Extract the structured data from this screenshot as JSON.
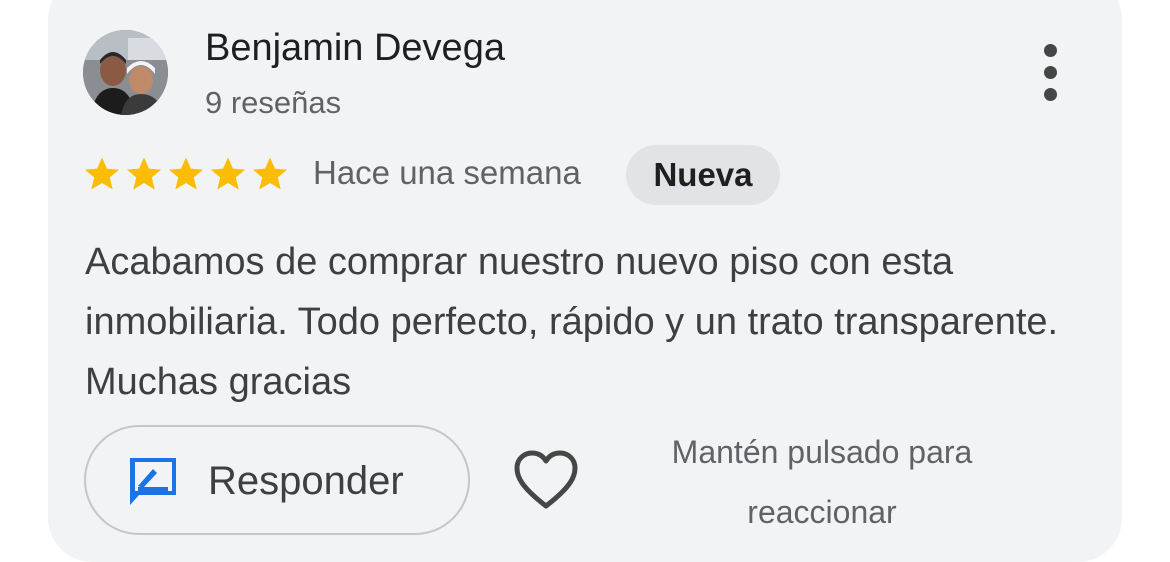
{
  "review": {
    "author_name": "Benjamin Devega",
    "review_count": "9 reseñas",
    "rating": 5,
    "rating_max": 5,
    "time": "Hace una semana",
    "badge": "Nueva",
    "text": "Acabamos de comprar nuestro nuevo piso con esta inmobiliaria. Todo perfecto, rápido y un trato transparente. Muchas gracias"
  },
  "actions": {
    "reply_label": "Responder",
    "react_hint": "Mantén pulsado para reaccionar"
  },
  "icons": {
    "avatar": "avatar-photo",
    "more": "more-vertical-icon",
    "star": "star-icon",
    "reply": "reply-edit-icon",
    "heart": "heart-outline-icon"
  },
  "colors": {
    "card_background": "#f2f3f5",
    "star": "#fbbc04",
    "reply_icon": "#1a73e8",
    "badge_background": "#e1e3e6",
    "text_primary": "#1f1f1f",
    "text_secondary": "#5f6368"
  }
}
